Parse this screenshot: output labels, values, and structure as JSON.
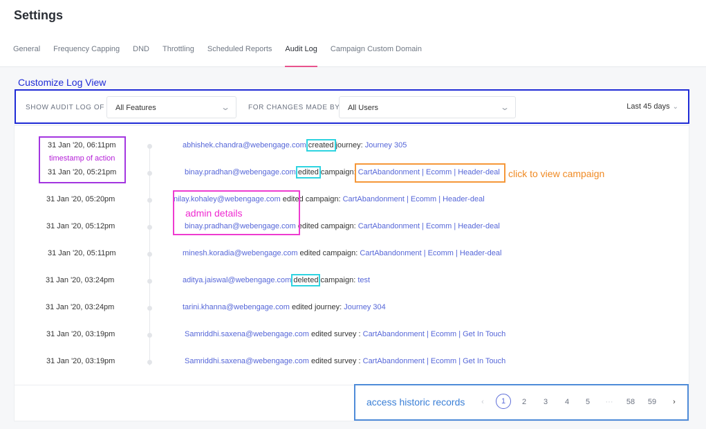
{
  "page": {
    "title": "Settings"
  },
  "tabs": [
    {
      "label": "General"
    },
    {
      "label": "Frequency Capping"
    },
    {
      "label": "DND"
    },
    {
      "label": "Throttling"
    },
    {
      "label": "Scheduled Reports"
    },
    {
      "label": "Audit Log",
      "active": true
    },
    {
      "label": "Campaign Custom Domain"
    }
  ],
  "annotations": {
    "customize": "Customize Log View",
    "timestamp": "timestamp of action",
    "campaign": "click to view campaign",
    "admin": "admin details",
    "history": "access historic records"
  },
  "filters": {
    "show_label": "SHOW AUDIT LOG OF",
    "show_value": "All Features",
    "changes_label": "FOR CHANGES MADE BY",
    "changes_value": "All Users",
    "date_range": "Last 45 days"
  },
  "log": [
    {
      "time": "31 Jan '20, 06:11pm",
      "user": "abhishek.chandra@webengage.com",
      "action": "created",
      "type": "journey:",
      "target": "Journey 305"
    },
    {
      "time": "31 Jan '20, 05:21pm",
      "user": "binay.pradhan@webengage.com",
      "action": "edited",
      "type": "campaign:",
      "target": "CartAbandonment | Ecomm | Header-deal"
    },
    {
      "time": "31 Jan '20, 05:20pm",
      "user": "nilay.kohaley@webengage.com",
      "action": "edited",
      "type": "campaign:",
      "target": "CartAbandonment | Ecomm | Header-deal"
    },
    {
      "time": "31 Jan '20, 05:12pm",
      "user": "binay.pradhan@webengage.com",
      "action": "edited",
      "type": "campaign:",
      "target": "CartAbandonment | Ecomm | Header-deal"
    },
    {
      "time": "31 Jan '20, 05:11pm",
      "user": "minesh.koradia@webengage.com",
      "action": "edited",
      "type": "campaign:",
      "target": "CartAbandonment | Ecomm | Header-deal"
    },
    {
      "time": "31 Jan '20, 03:24pm",
      "user": "aditya.jaiswal@webengage.com",
      "action": "deleted",
      "type": "campaign:",
      "target": "test"
    },
    {
      "time": "31 Jan '20, 03:24pm",
      "user": "tarini.khanna@webengage.com",
      "action": "edited",
      "type": "journey:",
      "target": "Journey 304"
    },
    {
      "time": "31 Jan '20, 03:19pm",
      "user": "Samriddhi.saxena@webengage.com",
      "action": "edited",
      "type": "survey :",
      "target": "CartAbandonment | Ecomm | Get In Touch"
    },
    {
      "time": "31 Jan '20, 03:19pm",
      "user": "Samriddhi.saxena@webengage.com",
      "action": "edited",
      "type": "survey :",
      "target": "CartAbandonment | Ecomm | Get In Touch"
    }
  ],
  "pagination": {
    "prev": "‹",
    "pages": [
      "1",
      "2",
      "3",
      "4",
      "5",
      "···",
      "58",
      "59"
    ],
    "current": "1",
    "next": "›"
  },
  "colors": {
    "accent_tab": "#e8528c",
    "link": "#5566d8",
    "annot_blue": "#1f2bd6",
    "annot_purple": "#a335e0",
    "annot_orange": "#f59738",
    "annot_magenta": "#ee3bd0",
    "annot_cyan": "#2ed3e0",
    "annot_pager": "#4e8bd8"
  }
}
